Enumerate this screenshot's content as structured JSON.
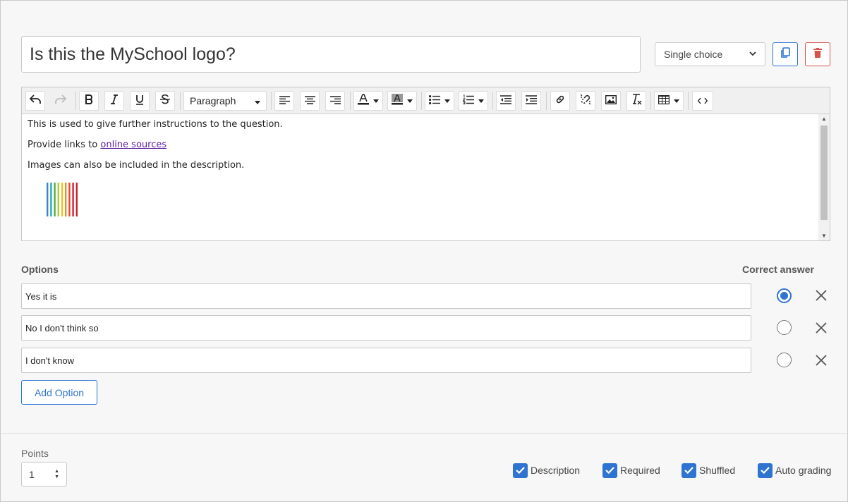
{
  "question": {
    "title": "Is this the MySchool logo?",
    "type_selected": "Single choice"
  },
  "editor": {
    "format_select": "Paragraph",
    "paragraphs": {
      "p1": "This is used to give further instructions to the question.",
      "p2_prefix": "Provide links to ",
      "p2_link": "online sources",
      "p3": "Images can also be included in the description."
    },
    "logo_colors": [
      "#3a86c8",
      "#2fa6b5",
      "#4caf50",
      "#a7c93a",
      "#f2c21b",
      "#f08a24",
      "#e8492f",
      "#d3213b",
      "#c1272d"
    ]
  },
  "options": {
    "label": "Options",
    "correct_label": "Correct answer",
    "items": [
      {
        "text": "Yes it is",
        "correct": true
      },
      {
        "text": "No I don't think so",
        "correct": false
      },
      {
        "text": "I don't know",
        "correct": false
      }
    ],
    "add_label": "Add Option"
  },
  "footer": {
    "points_label": "Points",
    "points_value": "1",
    "checkboxes": {
      "description": "Description",
      "required": "Required",
      "shuffled": "Shuffled",
      "auto_grading": "Auto grading"
    }
  },
  "colors": {
    "accent": "#2f74d0",
    "danger": "#d9534f"
  }
}
